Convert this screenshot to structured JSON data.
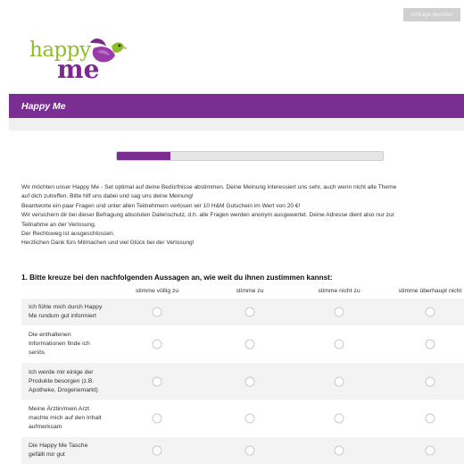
{
  "header": {
    "end_survey_button": "Umfrage beenden",
    "logo": {
      "line1": "happy",
      "line2": "me"
    },
    "banner_title": "Happy Me"
  },
  "progress": {
    "fraction": 0.2
  },
  "intro": {
    "lines": [
      "Wir möchten unser Happy Me - Set optimal auf deine Bedürfnisse abstimmen. Deine Meinung interessiert uns sehr, auch wenn nicht alle Theme",
      "auf dich zutreffen. Bitte hilf uns dabei und sag uns deine Meinung!",
      "Beantworte ein paar Fragen und unter allen Teilnehmern verlosen wir 10 H&M Gutschein im Wert von 20 €!",
      "Wir versichern dir bei dieser Befragung absoluten Datenschutz, d.h. alle Fragen werden anonym ausgewertet. Deine Adresse dient also nur zur",
      "Teilnahme an der Verlosung.",
      "Der Rechtsweg ist ausgeschlossen.",
      "Herzlichen Dank fürs Mitmachen und viel Glück bei der Verlosung!"
    ]
  },
  "question": {
    "title": "1. Bitte kreuze bei den nachfolgenden Aussagen an, wie weit du ihnen zustimmen kannst:",
    "columns": [
      "stimme völlig zu",
      "stimme zu",
      "stimme nicht zu",
      "stimme überhaupt nicht"
    ],
    "rows": [
      {
        "lines": [
          "Ich fühle mich durch Happy",
          "Me rundum gut informiert"
        ]
      },
      {
        "lines": [
          "Die enthaltenen",
          "Informationen finde ich",
          "seriös"
        ]
      },
      {
        "lines": [
          "Ich werde mir einige der",
          "Produkte besorgen (z.B.",
          "Apotheke, Drogeriemarkt)"
        ]
      },
      {
        "lines": [
          "Meine Ärztin/mein Arzt",
          "machte mich auf den Inhalt",
          "aufmerksam"
        ]
      },
      {
        "lines": [
          "Die Happy Me Tasche",
          "gefällt mir gut"
        ]
      }
    ]
  },
  "colors": {
    "brand_purple": "#7b2e91",
    "logo_green": "#8fbd2a"
  }
}
